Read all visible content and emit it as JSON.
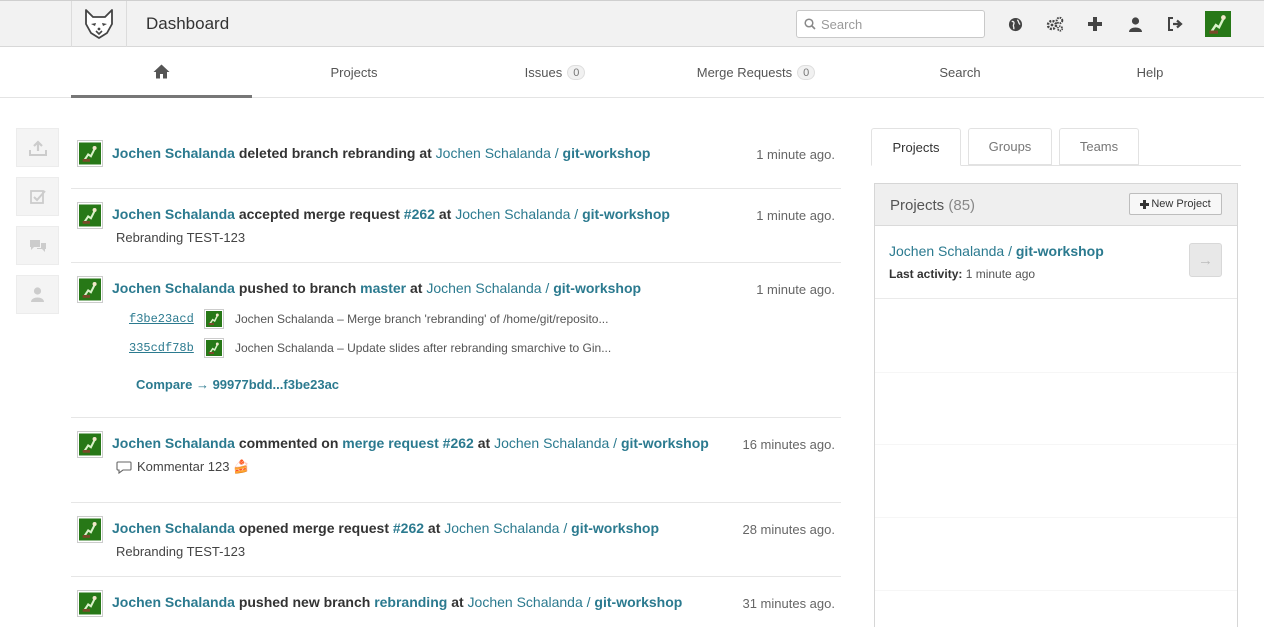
{
  "header": {
    "title": "Dashboard",
    "search_placeholder": "Search",
    "icons": [
      "globe-icon",
      "admin-gears-icon",
      "plus-icon",
      "profile-icon",
      "logout-icon"
    ]
  },
  "nav": {
    "home_icon": "home-icon",
    "items": [
      {
        "label": "Projects"
      },
      {
        "label": "Issues",
        "badge": "0"
      },
      {
        "label": "Merge Requests",
        "badge": "0"
      },
      {
        "label": "Search"
      },
      {
        "label": "Help"
      }
    ]
  },
  "sidebar": {
    "icons": [
      "upload-icon",
      "checkbox-icon",
      "comments-icon",
      "user-icon"
    ]
  },
  "events": [
    {
      "user": "Jochen Schalanda",
      "action": "deleted branch",
      "target": "rebranding",
      "at": "at",
      "project": "Jochen Schalanda / ",
      "project_bold": "git-workshop",
      "time": "1 minute ago."
    },
    {
      "user": "Jochen Schalanda",
      "action": "accepted merge request",
      "target": "#262",
      "at": "at",
      "project": "Jochen Schalanda / ",
      "project_bold": "git-workshop",
      "time": "1 minute ago.",
      "sub": "Rebranding TEST-123"
    },
    {
      "user": "Jochen Schalanda",
      "action": "pushed to branch",
      "target": "master",
      "at": "at",
      "project": "Jochen Schalanda / ",
      "project_bold": "git-workshop",
      "time": "1 minute ago.",
      "commits": [
        {
          "sha": "f3be23acd",
          "message": "Jochen Schalanda – Merge branch 'rebranding' of /home/git/reposito..."
        },
        {
          "sha": "335cdf78b",
          "message": "Jochen Schalanda – Update slides after rebranding smarchive to Gin..."
        }
      ],
      "compare": "Compare → 99977bdd...f3be23ac"
    },
    {
      "user": "Jochen Schalanda",
      "action": "commented on",
      "target": "merge request #262",
      "at": "at",
      "project": "Jochen Schalanda / ",
      "project_bold": "git-workshop",
      "time": "16 minutes ago.",
      "sub": "Kommentar 123 🍰"
    },
    {
      "user": "Jochen Schalanda",
      "action": "opened merge request",
      "target": "#262",
      "at": "at",
      "project": "Jochen Schalanda / ",
      "project_bold": "git-workshop",
      "time": "28 minutes ago.",
      "sub": "Rebranding TEST-123"
    },
    {
      "user": "Jochen Schalanda",
      "action": "pushed new branch",
      "target": "rebranding",
      "at": "at",
      "project": "Jochen Schalanda / ",
      "project_bold": "git-workshop",
      "time": "31 minutes ago."
    }
  ],
  "right_panel": {
    "tabs": [
      {
        "label": "Projects"
      },
      {
        "label": "Groups"
      },
      {
        "label": "Teams"
      }
    ],
    "panel_title": "Projects",
    "panel_count": "(85)",
    "new_project_label": "New Project",
    "project": {
      "namespace": "Jochen Schalanda / ",
      "name": "git-workshop",
      "activity_label": "Last activity:",
      "activity_value": "1 minute ago"
    }
  },
  "colors": {
    "link": "#2b7a8f",
    "header_bg": "#f2f2f2",
    "avatar_green": "#1f7a1f"
  }
}
